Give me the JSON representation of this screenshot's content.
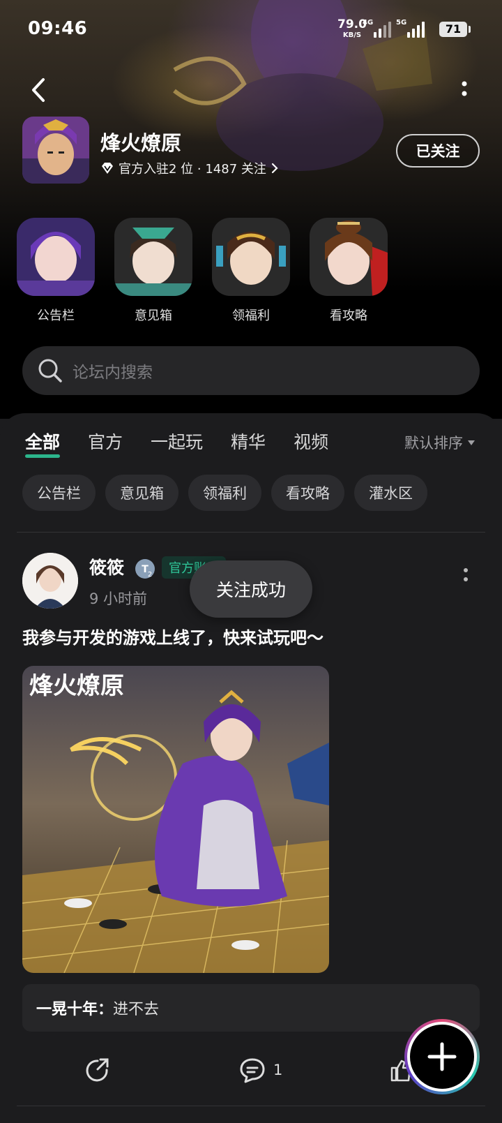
{
  "status_bar": {
    "time": "09:46",
    "net_speed": "79.0",
    "net_unit": "KB/S",
    "sim1": "4G",
    "sim2": "5G",
    "battery": "71"
  },
  "forum": {
    "title": "烽火燎原",
    "meta": "官方入驻2 位 · 1487 关注",
    "follow_label": "已关注"
  },
  "shortcuts": [
    {
      "label": "公告栏"
    },
    {
      "label": "意见箱"
    },
    {
      "label": "领福利"
    },
    {
      "label": "看攻略"
    }
  ],
  "search": {
    "placeholder": "论坛内搜索"
  },
  "tabs": [
    "全部",
    "官方",
    "一起玩",
    "精华",
    "视频"
  ],
  "sort_label": "默认排序",
  "chips": [
    "公告栏",
    "意见箱",
    "领福利",
    "看攻略",
    "灌水区"
  ],
  "post": {
    "author": "筱筱",
    "level": "2",
    "tag": "官方账号",
    "time": "9 小时前",
    "text": "我参与开发的游戏上线了，快来试玩吧～",
    "image_logo": "烽火燎原",
    "comment_user": "一晃十年：",
    "comment_text": "进不去",
    "comment_count": "1"
  },
  "toast": "关注成功",
  "colors": {
    "accent": "#2fd0a0",
    "background": "#1c1c1e",
    "chip": "#2b2b2e"
  }
}
